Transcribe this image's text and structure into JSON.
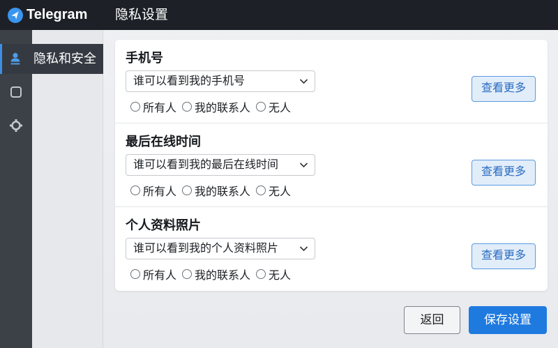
{
  "app": {
    "name": "Telegram",
    "logo_icon": "telegram-logo-icon"
  },
  "header": {
    "title": "隐私设置"
  },
  "sidebar": {
    "items": [
      {
        "label": "隐私和安全",
        "icon": "user-icon",
        "active": true
      },
      {
        "icon": "square-icon"
      },
      {
        "icon": "gear-icon"
      }
    ]
  },
  "sections": [
    {
      "title": "手机号",
      "select_value": "谁可以看到我的手机号",
      "options": [
        "所有人",
        "我的联系人",
        "无人"
      ],
      "more_label": "查看更多"
    },
    {
      "title": "最后在线时间",
      "select_value": "谁可以看到我的最后在线时间",
      "options": [
        "所有人",
        "我的联系人",
        "无人"
      ],
      "more_label": "查看更多"
    },
    {
      "title": "个人资料照片",
      "select_value": "谁可以看到我的个人资料照片",
      "options": [
        "所有人",
        "我的联系人",
        "无人"
      ],
      "more_label": "查看更多"
    }
  ],
  "footer": {
    "back_label": "返回",
    "save_label": "保存设置"
  },
  "theme": {
    "accent": "#1f7ae0",
    "header_bg": "#1d2127",
    "rail_bg": "#3c4148",
    "link": "#2a6cc0"
  }
}
